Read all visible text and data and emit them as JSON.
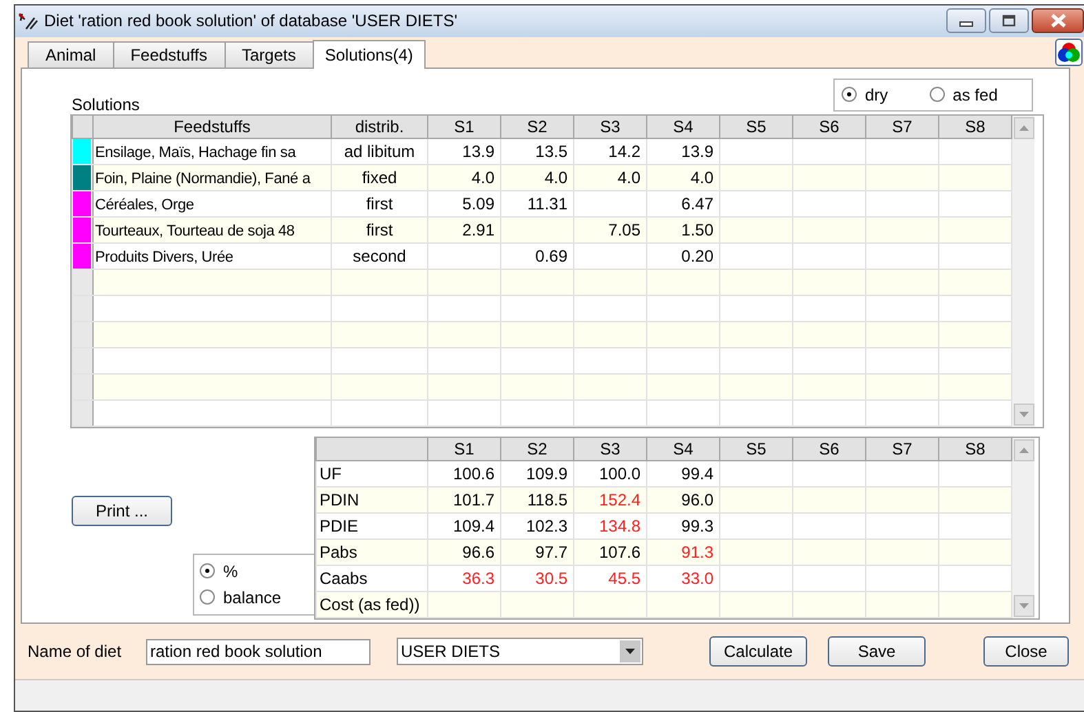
{
  "window": {
    "title": "Diet 'ration red book solution' of database 'USER DIETS'"
  },
  "tabs": [
    {
      "label": "Animal",
      "selected": false
    },
    {
      "label": "Feedstuffs",
      "selected": false
    },
    {
      "label": "Targets",
      "selected": false
    },
    {
      "label": "Solutions(4)",
      "selected": true
    }
  ],
  "solutions": {
    "label": "Solutions",
    "basis": [
      {
        "label": "dry",
        "selected": true
      },
      {
        "label": "as fed",
        "selected": false
      }
    ],
    "columns": [
      "Feedstuffs",
      "distrib.",
      "S1",
      "S2",
      "S3",
      "S4",
      "S5",
      "S6",
      "S7",
      "S8"
    ],
    "rows": [
      {
        "color": "#00ffff",
        "feedstuff": "Ensilage,  Maïs,  Hachage fin sa",
        "distrib": "ad libitum",
        "s1": "13.9",
        "s2": "13.5",
        "s3": "14.2",
        "s4": "13.9"
      },
      {
        "color": "#008080",
        "feedstuff": "Foin,  Plaine (Normandie),  Fané a",
        "distrib": "fixed",
        "s1": "4.0",
        "s2": "4.0",
        "s3": "4.0",
        "s4": "4.0"
      },
      {
        "color": "#ff00ff",
        "feedstuff": "Céréales,  Orge",
        "distrib": "first",
        "s1": "5.09",
        "s2": "11.31",
        "s4": "6.47"
      },
      {
        "color": "#ff00ff",
        "feedstuff": "Tourteaux,  Tourteau de soja 48",
        "distrib": "first",
        "s1": "2.91",
        "s3": "7.05",
        "s4": "1.50"
      },
      {
        "color": "#ff00ff",
        "feedstuff": "Produits Divers,  Urée",
        "distrib": "second",
        "s2": "0.69",
        "s4": "0.20"
      }
    ]
  },
  "results": {
    "columns": [
      "S1",
      "S2",
      "S3",
      "S4",
      "S5",
      "S6",
      "S7",
      "S8"
    ],
    "rows": [
      {
        "label": "UF",
        "values": [
          {
            "text": "100.6",
            "alert": false
          },
          {
            "text": "109.9",
            "alert": false
          },
          {
            "text": "100.0",
            "alert": false
          },
          {
            "text": "99.4",
            "alert": false
          }
        ]
      },
      {
        "label": "PDIN",
        "values": [
          {
            "text": "101.7",
            "alert": false
          },
          {
            "text": "118.5",
            "alert": false
          },
          {
            "text": "152.4",
            "alert": true
          },
          {
            "text": "96.0",
            "alert": false
          }
        ]
      },
      {
        "label": "PDIE",
        "values": [
          {
            "text": "109.4",
            "alert": false
          },
          {
            "text": "102.3",
            "alert": false
          },
          {
            "text": "134.8",
            "alert": true
          },
          {
            "text": "99.3",
            "alert": false
          }
        ]
      },
      {
        "label": "Pabs",
        "values": [
          {
            "text": "96.6",
            "alert": false
          },
          {
            "text": "97.7",
            "alert": false
          },
          {
            "text": "107.6",
            "alert": false
          },
          {
            "text": "91.3",
            "alert": true
          }
        ]
      },
      {
        "label": "Caabs",
        "values": [
          {
            "text": "36.3",
            "alert": true
          },
          {
            "text": "30.5",
            "alert": true
          },
          {
            "text": "45.5",
            "alert": true
          },
          {
            "text": "33.0",
            "alert": true
          }
        ]
      },
      {
        "label": "Cost (as fed))"
      }
    ]
  },
  "print_button": "Print ...",
  "display_mode": [
    {
      "label": "%",
      "selected": true
    },
    {
      "label": "balance",
      "selected": false
    }
  ],
  "name_of_diet": {
    "label": "Name of diet",
    "value": "ration red book solution"
  },
  "database": {
    "value": "USER DIETS"
  },
  "buttons": [
    "Calculate",
    "Save",
    "Close"
  ]
}
